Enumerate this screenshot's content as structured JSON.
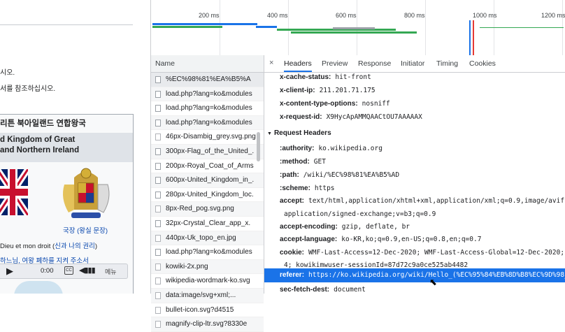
{
  "wiki": {
    "line1": "시오.",
    "line2": "서를 참조하십시오.",
    "infobox": {
      "ko_title": "리튼 북아일랜드 연합왕국",
      "en_title_1": "d Kingdom of Great",
      "en_title_2": "and Northern Ireland",
      "coa_caption": "국장 (왕실 문장)",
      "motto_text": "Dieu et mon droit (",
      "motto_link": "신과 나의 권리",
      "motto_end": ")",
      "anthem": "하느님, 여왕 폐하를 지켜 주소서",
      "player_time": "0:00",
      "player_menu": "메뉴"
    }
  },
  "timeline": {
    "ticks": [
      "200 ms",
      "400 ms",
      "600 ms",
      "800 ms",
      "1000 ms",
      "1200 ms"
    ]
  },
  "network": {
    "name_header": "Name",
    "requests": [
      "%EC%98%81%EA%B5%A",
      "load.php?lang=ko&modules",
      "load.php?lang=ko&modules",
      "load.php?lang=ko&modules",
      "46px-Disambig_grey.svg.png",
      "300px-Flag_of_the_United_.",
      "200px-Royal_Coat_of_Arms",
      "600px-United_Kingdom_in_.",
      "280px-United_Kingdom_loc.",
      "8px-Red_pog.svg.png",
      "32px-Crystal_Clear_app_x.",
      "440px-Uk_topo_en.jpg",
      "load.php?lang=ko&modules",
      "kowiki-2x.png",
      "wikipedia-wordmark-ko.svg",
      "data:image/svg+xml;...",
      "bullet-icon.svg?d4515",
      "magnify-clip-ltr.svg?8330e"
    ]
  },
  "detail": {
    "close_glyph": "×",
    "tabs": [
      "Headers",
      "Preview",
      "Response",
      "Initiator",
      "Timing",
      "Cookies"
    ],
    "response_headers": [
      {
        "k": "x-cache-status:",
        "v": "hit-front"
      },
      {
        "k": "x-client-ip:",
        "v": "211.201.71.175"
      },
      {
        "k": "x-content-type-options:",
        "v": "nosniff"
      },
      {
        "k": "x-request-id:",
        "v": "X9HycApAMMQAACtOU7AAAAAX"
      }
    ],
    "request_section": "Request Headers",
    "request_headers": [
      {
        "k": ":authority:",
        "v": "ko.wikipedia.org"
      },
      {
        "k": ":method:",
        "v": "GET"
      },
      {
        "k": ":path:",
        "v": "/wiki/%EC%98%81%EA%B5%AD"
      },
      {
        "k": ":scheme:",
        "v": "https"
      },
      {
        "k": "accept:",
        "v": "text/html,application/xhtml+xml,application/xml;q=0.9,image/avif,im"
      },
      {
        "k": "",
        "v": "application/signed-exchange;v=b3;q=0.9"
      },
      {
        "k": "accept-encoding:",
        "v": "gzip, deflate, br"
      },
      {
        "k": "accept-language:",
        "v": "ko-KR,ko;q=0.9,en-US;q=0.8,en;q=0.7"
      },
      {
        "k": "cookie:",
        "v": "WMF-Last-Access=12-Dec-2020; WMF-Last-Access-Global=12-Dec-2020; Ge"
      },
      {
        "k": "",
        "v": "4; kowikimwuser-sessionId=87d72c9a0ce525ab4482"
      },
      {
        "k": "referer:",
        "v": "https://ko.wikipedia.org/wiki/Hello_(%EC%95%84%EB%8D%B8%EC%9D%98_%E"
      },
      {
        "k": "sec-fetch-dest:",
        "v": "document"
      }
    ]
  },
  "colors": {
    "accent": "#1a73e8",
    "timeline_green": "#34a853",
    "timeline_blue": "#1a73e8"
  }
}
